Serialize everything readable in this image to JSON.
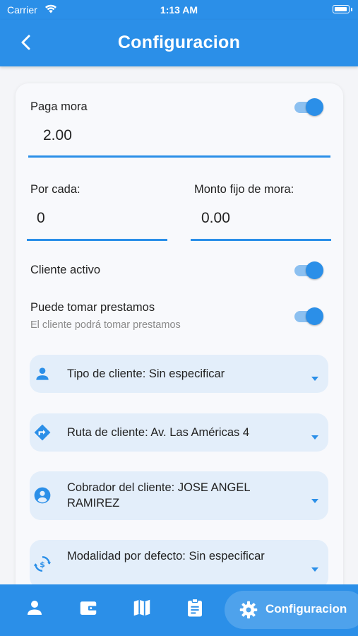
{
  "status_bar": {
    "carrier": "Carrier",
    "time": "1:13 AM"
  },
  "header": {
    "title": "Configuracion"
  },
  "form": {
    "paga_mora": {
      "label": "Paga mora",
      "value": "2.00",
      "enabled": true
    },
    "por_cada": {
      "label": "Por cada:",
      "value": "0"
    },
    "monto_fijo": {
      "label": "Monto fijo de mora:",
      "value": "0.00"
    },
    "cliente_activo": {
      "label": "Cliente activo",
      "enabled": true
    },
    "puede_tomar": {
      "label": "Puede tomar prestamos",
      "description": "El cliente podrá tomar prestamos",
      "enabled": true
    }
  },
  "dropdowns": [
    {
      "icon": "person-icon",
      "text": "Tipo de cliente: Sin especificar"
    },
    {
      "icon": "route-icon",
      "text": "Ruta de cliente: Av. Las Américas 4"
    },
    {
      "icon": "account-circle-icon",
      "text": "Cobrador del cliente: JOSE ANGEL RAMIREZ"
    },
    {
      "icon": "sync-payment-icon",
      "text": "Modalidad por defecto: Sin especificar"
    }
  ],
  "bottom_nav": {
    "items": [
      {
        "icon": "person-icon"
      },
      {
        "icon": "wallet-icon"
      },
      {
        "icon": "map-icon"
      },
      {
        "icon": "clipboard-icon"
      }
    ],
    "active": {
      "icon": "gear-icon",
      "label": "Configuracion"
    }
  },
  "colors": {
    "primary": "#2b8fe8",
    "toggle_track": "#8cc0f0",
    "dropdown_bg": "#e3eefa",
    "background": "#f4f5f8"
  }
}
